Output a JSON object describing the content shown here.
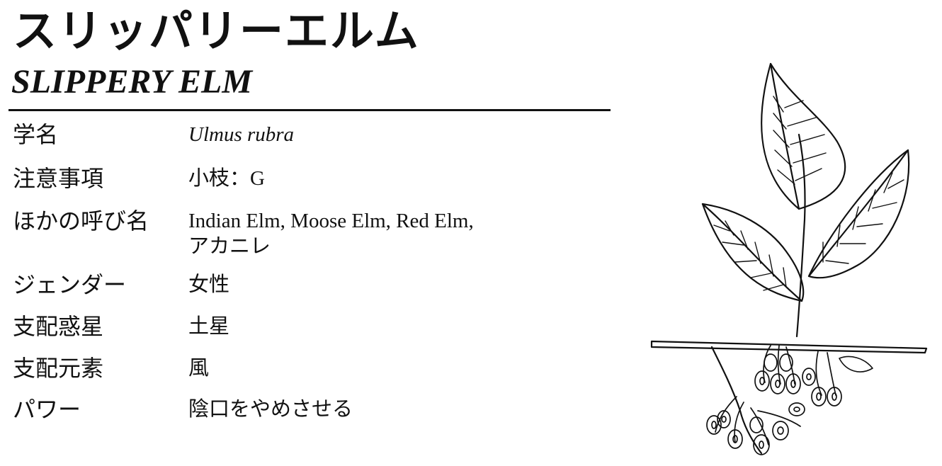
{
  "title_jp": "スリッパリーエルム",
  "title_en": "SLIPPERY ELM",
  "rows": [
    {
      "label": "学名",
      "value": "Ulmus rubra"
    },
    {
      "label": "注意事項",
      "value": "小枝：G"
    },
    {
      "label": "ほかの呼び名",
      "value_line1": "Indian Elm,  Moose Elm,  Red Elm,",
      "value_line2": "アカニレ"
    },
    {
      "label": "ジェンダー",
      "value": "女性"
    },
    {
      "label": "支配惑星",
      "value": "土星"
    },
    {
      "label": "支配元素",
      "value": "風"
    },
    {
      "label": "パワー",
      "value": "陰口をやめさせる"
    }
  ],
  "illustration": {
    "subject": "slippery elm leaves and winged seeds",
    "style": "black ink line drawing"
  }
}
